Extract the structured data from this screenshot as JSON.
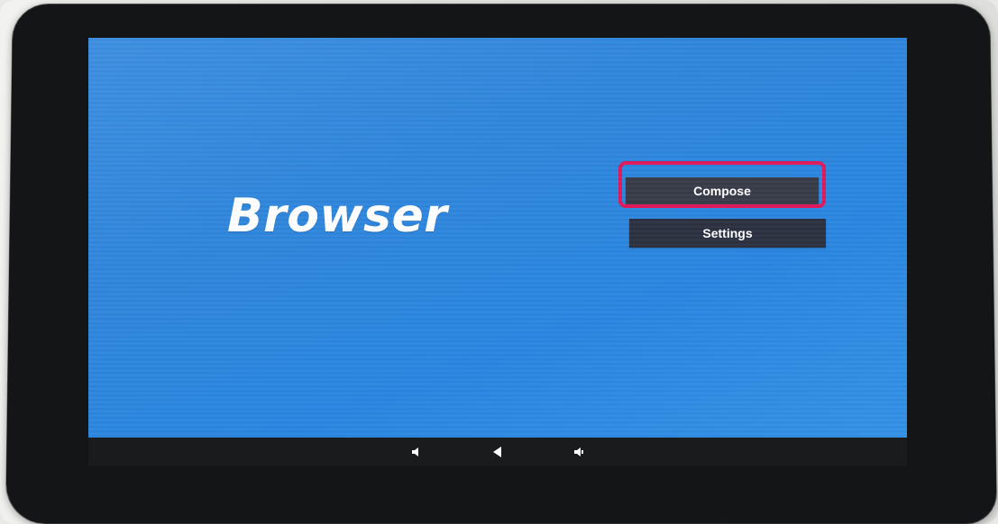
{
  "app": {
    "title": "Browser"
  },
  "menu": {
    "compose_label": "Compose",
    "settings_label": "Settings"
  },
  "navbar": {
    "buttons": [
      "volume-down-icon",
      "back-icon",
      "volume-up-icon"
    ]
  },
  "colors": {
    "screen_blue": "#2f86dc",
    "button_bg": "#2b3140",
    "highlight": "#e0185a"
  }
}
